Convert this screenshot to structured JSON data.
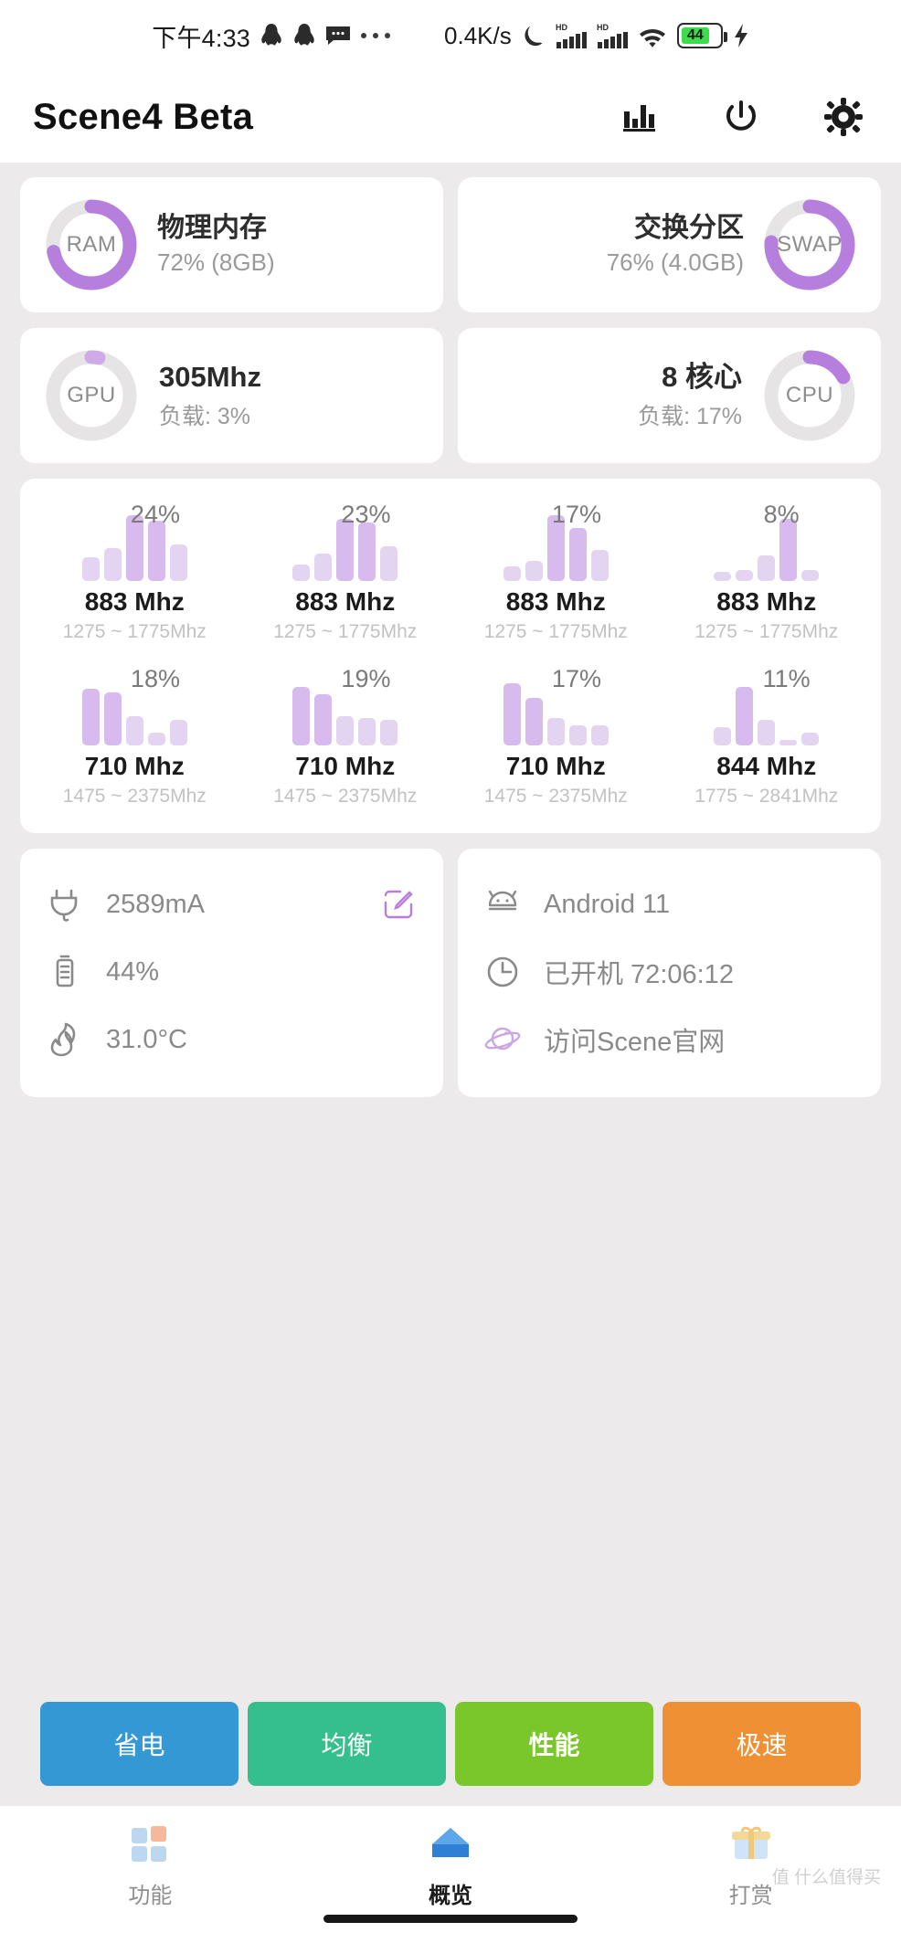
{
  "statusbar": {
    "time": "下午4:33",
    "icons_left": [
      "qq-icon",
      "qq-icon",
      "sms-icon",
      "more-dots-icon"
    ],
    "network_speed": "0.4K/s",
    "icons_right": [
      "moon-icon",
      "hd-signal-icon",
      "hd-signal-icon",
      "wifi-icon",
      "battery-icon",
      "charging-bolt-icon"
    ],
    "battery_percent": "44"
  },
  "appbar": {
    "title": "Scene4 Beta",
    "actions": [
      {
        "name": "chart-icon"
      },
      {
        "name": "power-icon"
      },
      {
        "name": "gear-icon"
      }
    ]
  },
  "memory": [
    {
      "ring_label": "RAM",
      "title": "物理内存",
      "detail": "72% (8GB)",
      "percent": 72,
      "side": "left"
    },
    {
      "ring_label": "SWAP",
      "title": "交换分区",
      "detail": "76% (4.0GB)",
      "percent": 76,
      "side": "right"
    }
  ],
  "processors": [
    {
      "ring_label": "GPU",
      "value": "305Mhz",
      "load": "负载: 3%",
      "percent": 3,
      "side": "left"
    },
    {
      "ring_label": "CPU",
      "value": "8 核心",
      "load": "负载: 17%",
      "percent": 17,
      "side": "right"
    }
  ],
  "cores": [
    {
      "percent": "24%",
      "freq": "883 Mhz",
      "range": "1275 ~ 1775Mhz",
      "bars": [
        26,
        36,
        72,
        66,
        40
      ],
      "hi": [
        2,
        3
      ]
    },
    {
      "percent": "23%",
      "freq": "883 Mhz",
      "range": "1275 ~ 1775Mhz",
      "bars": [
        18,
        30,
        68,
        64,
        38
      ],
      "hi": [
        2,
        3
      ]
    },
    {
      "percent": "17%",
      "freq": "883 Mhz",
      "range": "1275 ~ 1775Mhz",
      "bars": [
        16,
        22,
        72,
        58,
        34
      ],
      "hi": [
        2,
        3
      ]
    },
    {
      "percent": "8%",
      "freq": "883 Mhz",
      "range": "1275 ~ 1775Mhz",
      "bars": [
        10,
        12,
        28,
        68,
        12
      ],
      "hi": [
        3
      ]
    },
    {
      "percent": "18%",
      "freq": "710 Mhz",
      "range": "1475 ~ 2375Mhz",
      "bars": [
        62,
        58,
        32,
        14,
        28
      ],
      "hi": [
        0,
        1
      ]
    },
    {
      "percent": "19%",
      "freq": "710 Mhz",
      "range": "1475 ~ 2375Mhz",
      "bars": [
        64,
        56,
        32,
        30,
        28
      ],
      "hi": [
        0,
        1
      ]
    },
    {
      "percent": "17%",
      "freq": "710 Mhz",
      "range": "1475 ~ 2375Mhz",
      "bars": [
        68,
        52,
        30,
        22,
        22
      ],
      "hi": [
        0,
        1
      ]
    },
    {
      "percent": "11%",
      "freq": "844 Mhz",
      "range": "1775 ~ 2841Mhz",
      "bars": [
        20,
        64,
        28,
        6,
        14
      ],
      "hi": [
        1
      ]
    }
  ],
  "device_left": [
    {
      "icon": "plug-icon",
      "text": "2589mA",
      "action_icon": "edit-icon"
    },
    {
      "icon": "battery-vertical-icon",
      "text": "44%"
    },
    {
      "icon": "flame-icon",
      "text": "31.0°C"
    }
  ],
  "device_right": [
    {
      "icon": "android-icon",
      "text": "Android 11"
    },
    {
      "icon": "clock-icon",
      "text": "已开机  72:06:12"
    },
    {
      "icon": "planet-icon",
      "text": "访问Scene官网"
    }
  ],
  "modes": [
    {
      "label": "省电",
      "color": "#3398d4",
      "selected": false
    },
    {
      "label": "均衡",
      "color": "#36bf8e",
      "selected": false
    },
    {
      "label": "性能",
      "color": "#79c72b",
      "selected": true
    },
    {
      "label": "极速",
      "color": "#f09035",
      "selected": false
    }
  ],
  "nav": [
    {
      "label": "功能",
      "icon": "squares-icon",
      "active": false
    },
    {
      "label": "概览",
      "icon": "home-icon",
      "active": true
    },
    {
      "label": "打赏",
      "icon": "gift-icon",
      "active": false
    }
  ],
  "watermark": "值 什么值得买",
  "colors": {
    "accent_purple": "#b77fdd",
    "ring_track": "#e6e4e5",
    "card_bg": "#ffffff",
    "page_bg": "#eceaeb"
  }
}
